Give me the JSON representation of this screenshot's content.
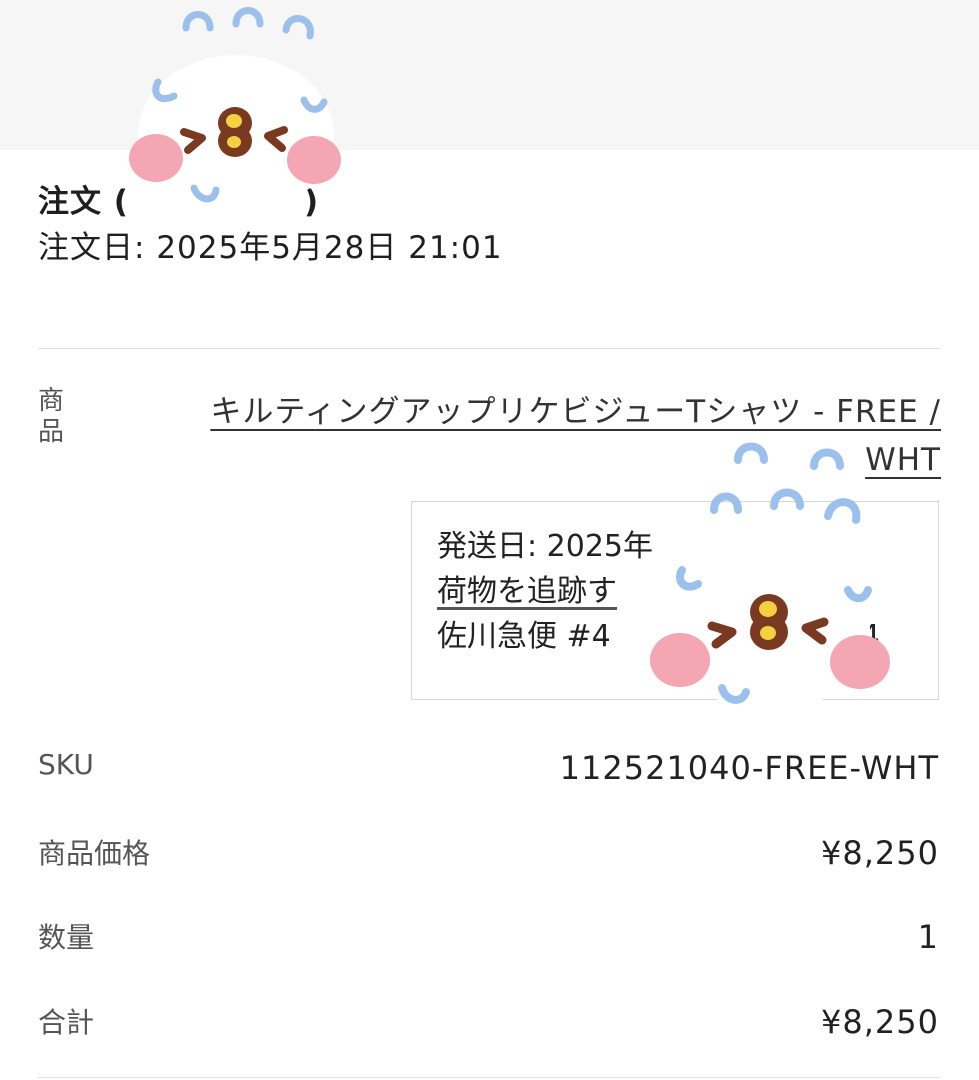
{
  "order": {
    "title": "注文 (",
    "title_end": ")",
    "date_label": "注文日:",
    "date_value": "2025年5月28日 21:01"
  },
  "item": {
    "label": "商品",
    "name": "キルティングアップリケビジューTシャツ - FREE / WHT"
  },
  "shipment": {
    "ship_label": "発送日:",
    "ship_value_visible": "2025年",
    "track_link": "荷物を追跡す",
    "carrier": "佐川急便",
    "tracking_visible_start": "#4",
    "tracking_visible_end": "4"
  },
  "rows": [
    {
      "label": "SKU",
      "value": "112521040-FREE-WHT"
    },
    {
      "label": "商品価格",
      "value": "¥8,250"
    },
    {
      "label": "数量",
      "value": "1"
    },
    {
      "label": "合計",
      "value": "¥8,250"
    }
  ],
  "stickers": [
    {
      "name": "kawaii-bird-sticker",
      "colors": {
        "face": "#ffffff",
        "cheek": "#f4a7b2",
        "beak": "#7a3a22",
        "beak_dot": "#f5d142",
        "marks": "#9cc0ec"
      }
    }
  ]
}
